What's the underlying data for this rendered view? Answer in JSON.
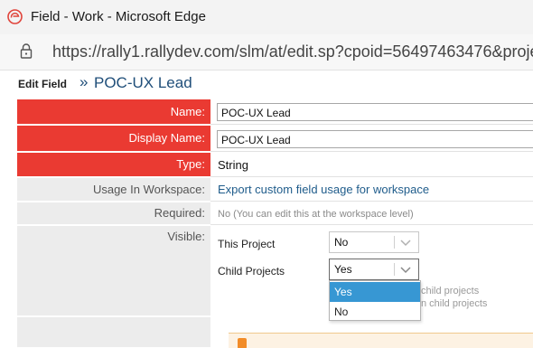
{
  "browser": {
    "window_title": "Field - Work - Microsoft Edge",
    "url": "https://rally1.rallydev.com/slm/at/edit.sp?cpoid=56497463476&proje"
  },
  "header": {
    "edit_field": "Edit Field",
    "arrow": "»",
    "title": "POC-UX Lead"
  },
  "form": {
    "name": {
      "label": "Name:",
      "value": "POC-UX Lead"
    },
    "display_name": {
      "label": "Display Name:",
      "value": "POC-UX Lead"
    },
    "type": {
      "label": "Type:",
      "value": "String"
    },
    "usage": {
      "label": "Usage In Workspace:",
      "link": "Export custom field usage for workspace"
    },
    "required": {
      "label": "Required:",
      "value": "No (You can edit this at the workspace level)"
    },
    "visible": {
      "label": "Visible:",
      "this_project": {
        "label": "This Project",
        "selected": "No"
      },
      "child_projects": {
        "label": "Child Projects",
        "selected": "Yes"
      },
      "options": [
        "Yes",
        "No"
      ],
      "hint_line1": "child projects",
      "hint_line2": "n child projects"
    }
  },
  "colors": {
    "required_label_bg": "#ea3a32",
    "optional_label_bg": "#ececec",
    "link": "#1f5c8b",
    "selected_option": "#3797d3"
  }
}
